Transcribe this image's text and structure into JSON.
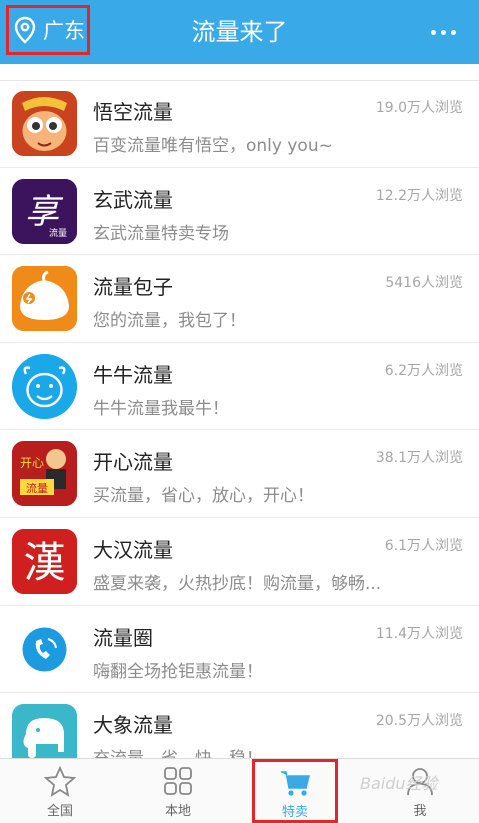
{
  "header": {
    "location": "广东",
    "title": "流量来了"
  },
  "list": [
    {
      "name": "悟空流量",
      "desc": "百变流量唯有悟空，only you~",
      "views": "19.0万人浏览"
    },
    {
      "name": "玄武流量",
      "desc": "玄武流量特卖专场",
      "views": "12.2万人浏览"
    },
    {
      "name": "流量包子",
      "desc": "您的流量，我包了！",
      "views": "5416人浏览"
    },
    {
      "name": "牛牛流量",
      "desc": "牛牛流量我最牛！",
      "views": "6.2万人浏览"
    },
    {
      "name": "开心流量",
      "desc": "买流量，省心，放心，开心！",
      "views": "38.1万人浏览"
    },
    {
      "name": "大汉流量",
      "desc": "盛夏来袭，火热抄底！购流量，够畅...",
      "views": "6.1万人浏览"
    },
    {
      "name": "流量圈",
      "desc": "嗨翻全场抢钜惠流量！",
      "views": "11.4万人浏览"
    },
    {
      "name": "大象流量",
      "desc": "充流量，省，快，稳！",
      "views": "20.5万人浏览"
    }
  ],
  "icon_text": {
    "xuanwu": "享",
    "xuanwu_sub": "流量",
    "kaixin": "开心",
    "kaixin_sub": "流量",
    "dahan": "漢"
  },
  "tabs": [
    {
      "label": "全国"
    },
    {
      "label": "本地"
    },
    {
      "label": "特卖"
    },
    {
      "label": "我"
    }
  ],
  "watermark": "Baidu经验",
  "colors": {
    "header": "#3aa9e8",
    "highlight": "#e5252a"
  }
}
